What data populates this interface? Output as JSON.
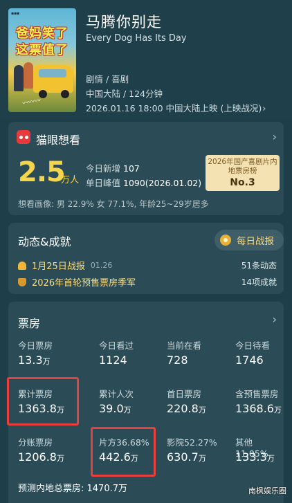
{
  "movie": {
    "title": "马腾你别走",
    "title_en": "Every Dog Has Its Day",
    "genre": "剧情 / 喜剧",
    "region_runtime": "中国大陆 / 124分钟",
    "release": "2026.01.16 18:00 中国大陆上映 (上映战况)",
    "poster_slogan_line1": "爸妈笑了",
    "poster_slogan_line2": "这票值了"
  },
  "maoyan_want": {
    "header": "猫眼想看",
    "count": "2.5",
    "count_unit": "万人",
    "today_new_label": "今日新增",
    "today_new_value": "107",
    "peak_label": "单日峰值",
    "peak_value": "1090(2026.01.02)",
    "rank_title": "2026年国产喜剧片内地票房榜",
    "rank_value": "No.3",
    "profile": "想看画像: 男 22.9%  女 77.1%,  年龄25~29岁居多"
  },
  "dynamics": {
    "header": "动态&成就",
    "daily_report_button": "每日战报",
    "items": [
      {
        "text": "1月25日战报",
        "date": "01.26",
        "right": "51条动态"
      },
      {
        "text": "2026年首轮预售票房季军",
        "date": "",
        "right": "14项成就"
      }
    ]
  },
  "box_office": {
    "header": "票房",
    "cells": [
      {
        "label": "今日票房",
        "value": "13.3",
        "unit": "万"
      },
      {
        "label": "今日看过",
        "value": "1124",
        "unit": ""
      },
      {
        "label": "当前在看",
        "value": "728",
        "unit": ""
      },
      {
        "label": "今日待看",
        "value": "1746",
        "unit": ""
      },
      {
        "label": "累计票房",
        "value": "1363.8",
        "unit": "万"
      },
      {
        "label": "累计人次",
        "value": "39.0",
        "unit": "万"
      },
      {
        "label": "首日票房",
        "value": "220.8",
        "unit": "万"
      },
      {
        "label": "含预售票房",
        "value": "1368.6",
        "unit": "万"
      },
      {
        "label": "分账票房",
        "value": "1206.8",
        "unit": "万"
      },
      {
        "label": "片方36.68%",
        "value": "442.6",
        "unit": "万"
      },
      {
        "label": "影院52.27%",
        "value": "630.7",
        "unit": "万"
      },
      {
        "label": "其他11.05%",
        "value": "133.3",
        "unit": "万"
      }
    ],
    "forecast": "预测内地总票房: 1470.7万"
  },
  "watermark": "南枫娱乐圈",
  "colors": {
    "background": "#1e3f4a",
    "card": "#2b4c56",
    "accent_yellow": "#f6d54a",
    "highlight_red": "#e8403d"
  }
}
